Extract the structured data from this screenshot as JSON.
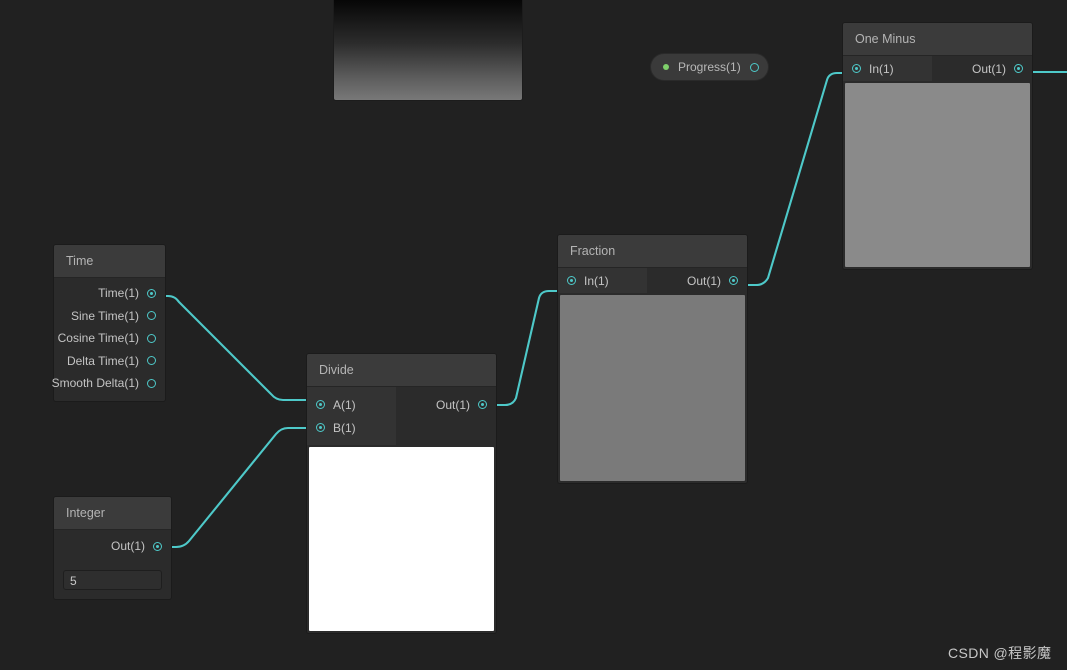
{
  "canvas": {
    "background_color": "#212121",
    "edge_color": "#4ec9c9"
  },
  "gradient_preview": {
    "name": "master-preview",
    "top_color": "#000000",
    "bottom_color": "#787878"
  },
  "property_pill": {
    "label": "Progress(1)",
    "dot_color": "#7ecf6a",
    "port_connected": false
  },
  "nodes": {
    "time": {
      "title": "Time",
      "outputs": [
        {
          "label": "Time(1)",
          "connected": true
        },
        {
          "label": "Sine Time(1)",
          "connected": false
        },
        {
          "label": "Cosine Time(1)",
          "connected": false
        },
        {
          "label": "Delta Time(1)",
          "connected": false
        },
        {
          "label": "Smooth Delta(1)",
          "connected": false
        }
      ]
    },
    "integer": {
      "title": "Integer",
      "output": {
        "label": "Out(1)",
        "connected": true
      },
      "value": "5",
      "value_placeholder": "0"
    },
    "divide": {
      "title": "Divide",
      "inputs": [
        {
          "label": "A(1)",
          "connected": true
        },
        {
          "label": "B(1)",
          "connected": true
        }
      ],
      "output": {
        "label": "Out(1)",
        "connected": true
      },
      "preview_color": "#ffffff"
    },
    "fraction": {
      "title": "Fraction",
      "input": {
        "label": "In(1)",
        "connected": true
      },
      "output": {
        "label": "Out(1)",
        "connected": true
      },
      "preview_color": "#7a7a7a"
    },
    "one_minus": {
      "title": "One Minus",
      "input": {
        "label": "In(1)",
        "connected": true
      },
      "output": {
        "label": "Out(1)",
        "connected": true
      },
      "preview_color": "#8a8a8a"
    }
  },
  "watermark": {
    "text": "CSDN @程影魔"
  }
}
